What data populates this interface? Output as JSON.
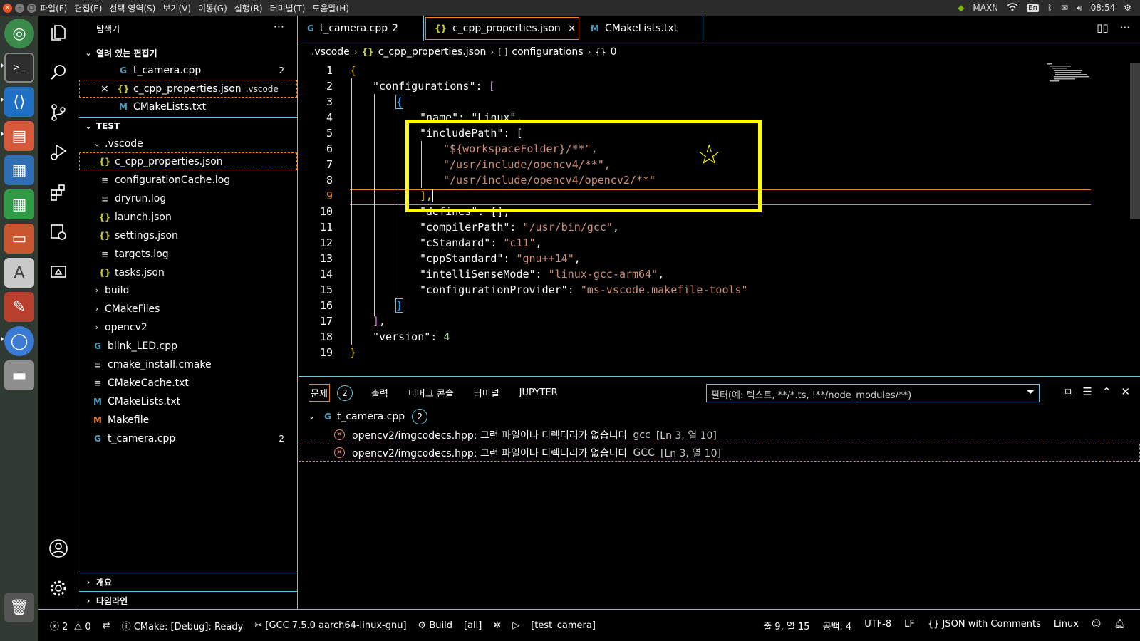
{
  "menu": [
    "파일(F)",
    "편집(E)",
    "선택 영역(S)",
    "보기(V)",
    "이동(G)",
    "실행(R)",
    "터미널(T)",
    "도움말(H)"
  ],
  "tray": {
    "nvidia": "MAXN",
    "lang": "En",
    "time": "08:54"
  },
  "sidebar": {
    "title": "탐색기",
    "open_editors_label": "열려 있는 편집기",
    "open_editors": [
      {
        "name": "t_camera.cpp",
        "badge": "2"
      },
      {
        "name": "c_cpp_properties.json",
        "desc": ".vscode"
      },
      {
        "name": "CMakeLists.txt"
      }
    ],
    "project_label": "TEST",
    "vscode_folder": ".vscode",
    "vscode_files": [
      "c_cpp_properties.json",
      "configurationCache.log",
      "dryrun.log",
      "launch.json",
      "settings.json",
      "targets.log",
      "tasks.json"
    ],
    "folders": [
      "build",
      "CMakeFiles",
      "opencv2"
    ],
    "files": [
      {
        "name": "blink_LED.cpp"
      },
      {
        "name": "cmake_install.cmake"
      },
      {
        "name": "CMakeCache.txt"
      },
      {
        "name": "CMakeLists.txt"
      },
      {
        "name": "Makefile"
      },
      {
        "name": "t_camera.cpp",
        "badge": "2"
      }
    ],
    "outline_label": "개요",
    "timeline_label": "타임라인"
  },
  "tabs": [
    {
      "name": "t_camera.cpp",
      "suffix": "2"
    },
    {
      "name": "c_cpp_properties.json"
    },
    {
      "name": "CMakeLists.txt"
    }
  ],
  "breadcrumb": [
    ".vscode",
    "c_cpp_properties.json",
    "configurations",
    "0"
  ],
  "editor": {
    "line_numbers": [
      "1",
      "2",
      "3",
      "4",
      "5",
      "6",
      "7",
      "8",
      "9",
      "10",
      "11",
      "12",
      "13",
      "14",
      "15",
      "16",
      "17",
      "18",
      "19"
    ],
    "name_key": "\"name\": \"Linux\",",
    "include_key": "\"includePath\": [",
    "inc1": "\"${workspaceFolder}/**\",",
    "inc2": "\"/usr/include/opencv4/**\",",
    "inc3": "\"/usr/include/opencv4/opencv2/**\"",
    "defines": "\"defines\": [],",
    "compilerPath_key": "\"compilerPath\": ",
    "compilerPath_val": "\"/usr/bin/gcc\"",
    "cStandard_key": "\"cStandard\": ",
    "cStandard_val": "\"c11\"",
    "cppStandard_key": "\"cppStandard\": ",
    "cppStandard_val": "\"gnu++14\"",
    "intelli_key": "\"intelliSenseMode\": ",
    "intelli_val": "\"linux-gcc-arm64\"",
    "provider_key": "\"configurationProvider\": ",
    "provider_val": "\"ms-vscode.makefile-tools\"",
    "configurations_key": "\"configurations\": ",
    "version_key": "\"version\": ",
    "version_val": "4"
  },
  "panel": {
    "tabs": [
      "문제",
      "출력",
      "디버그 콘솔",
      "터미널",
      "JUPYTER"
    ],
    "problem_count": "2",
    "filter_placeholder": "필터(예: 텍스트, **/*.ts, !**/node_modules/**)",
    "file": "t_camera.cpp",
    "file_count": "2",
    "problems": [
      {
        "msg": "opencv2/imgcodecs.hpp: 그런 파일이나 디렉터리가 없습니다",
        "src": "gcc",
        "loc": "[Ln 3, 열 10]"
      },
      {
        "msg": "opencv2/imgcodecs.hpp: 그런 파일이나 디렉터리가 없습니다",
        "src": "GCC",
        "loc": "[Ln 3, 열 10]"
      }
    ]
  },
  "status": {
    "errors": "2",
    "warnings": "0",
    "cmake": "CMake: [Debug]: Ready",
    "kit": "[GCC 7.5.0 aarch64-linux-gnu]",
    "build": "Build",
    "target": "[all]",
    "launch": "[test_camera]",
    "position": "줄 9, 열 15",
    "spaces": "공백: 4",
    "encoding": "UTF-8",
    "eol": "LF",
    "language": "JSON with Comments",
    "config": "Linux"
  }
}
